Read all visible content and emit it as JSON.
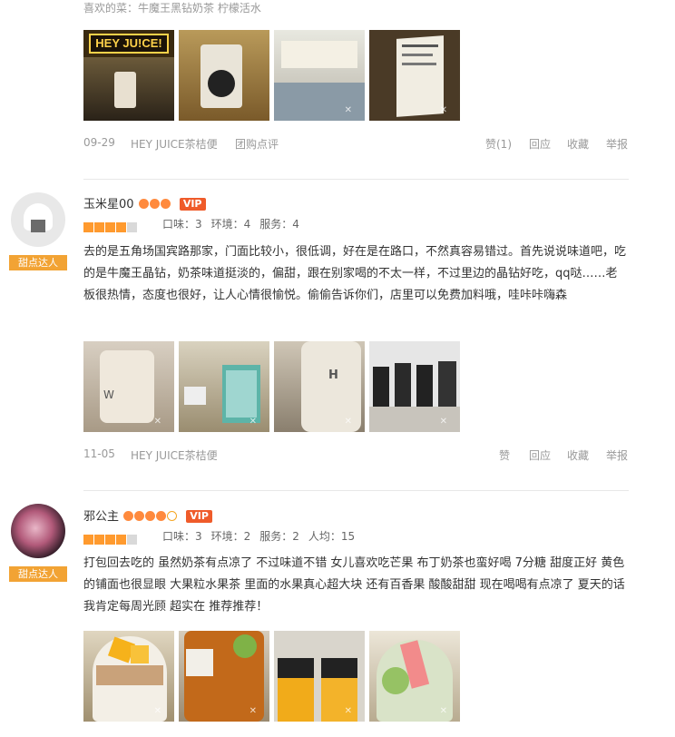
{
  "review0": {
    "likes": "喜欢的菜：牛魔王黑钻奶茶 柠檬活水",
    "photo_sign_text": "HEY JU!CE!",
    "date": "09-29",
    "shop": "HEY JUICE茶桔便",
    "source": "团购点评",
    "actions": [
      "赞(1)",
      "回应",
      "收藏",
      "举报"
    ]
  },
  "review1": {
    "badge": "甜点达人",
    "name": "玉米星00",
    "vip": "VIP",
    "rating": 4,
    "scores": [
      "口味：3",
      "环境：4",
      "服务：4"
    ],
    "text": "去的是五角场国宾路那家，门面比较小，很低调，好在是在路口，不然真容易错过。首先说说味道吧，吃的是牛魔王晶钻，奶茶味道挺淡的，偏甜，跟在别家喝的不太一样，不过里边的晶钻好吃，qq哒……老板很热情，态度也很好，让人心情很愉悦。偷偷告诉你们，店里可以免费加料哦，哇咔咔嗨森",
    "date": "11-05",
    "shop": "HEY JUICE茶桔便",
    "actions": [
      "赞",
      "回应",
      "收藏",
      "举报"
    ]
  },
  "review2": {
    "badge": "甜点达人",
    "name": "邪公主",
    "vip": "VIP",
    "rating": 4,
    "scores": [
      "口味：3",
      "环境：2",
      "服务：2",
      "人均：15"
    ],
    "text": "打包回去吃的 虽然奶茶有点凉了 不过味道不错 女儿喜欢吃芒果 布丁奶茶也蛮好喝 7分糖 甜度正好 黄色的铺面也很显眼 大果粒水果茶 里面的水果真心超大块 还有百香果 酸酸甜甜 现在喝喝有点凉了 夏天的话 我肯定每周光顾 超实在 推荐推荐！"
  },
  "colors": {
    "accent": "#ff9a2e",
    "vip": "#ef5b2a",
    "badge": "#f2a334"
  }
}
